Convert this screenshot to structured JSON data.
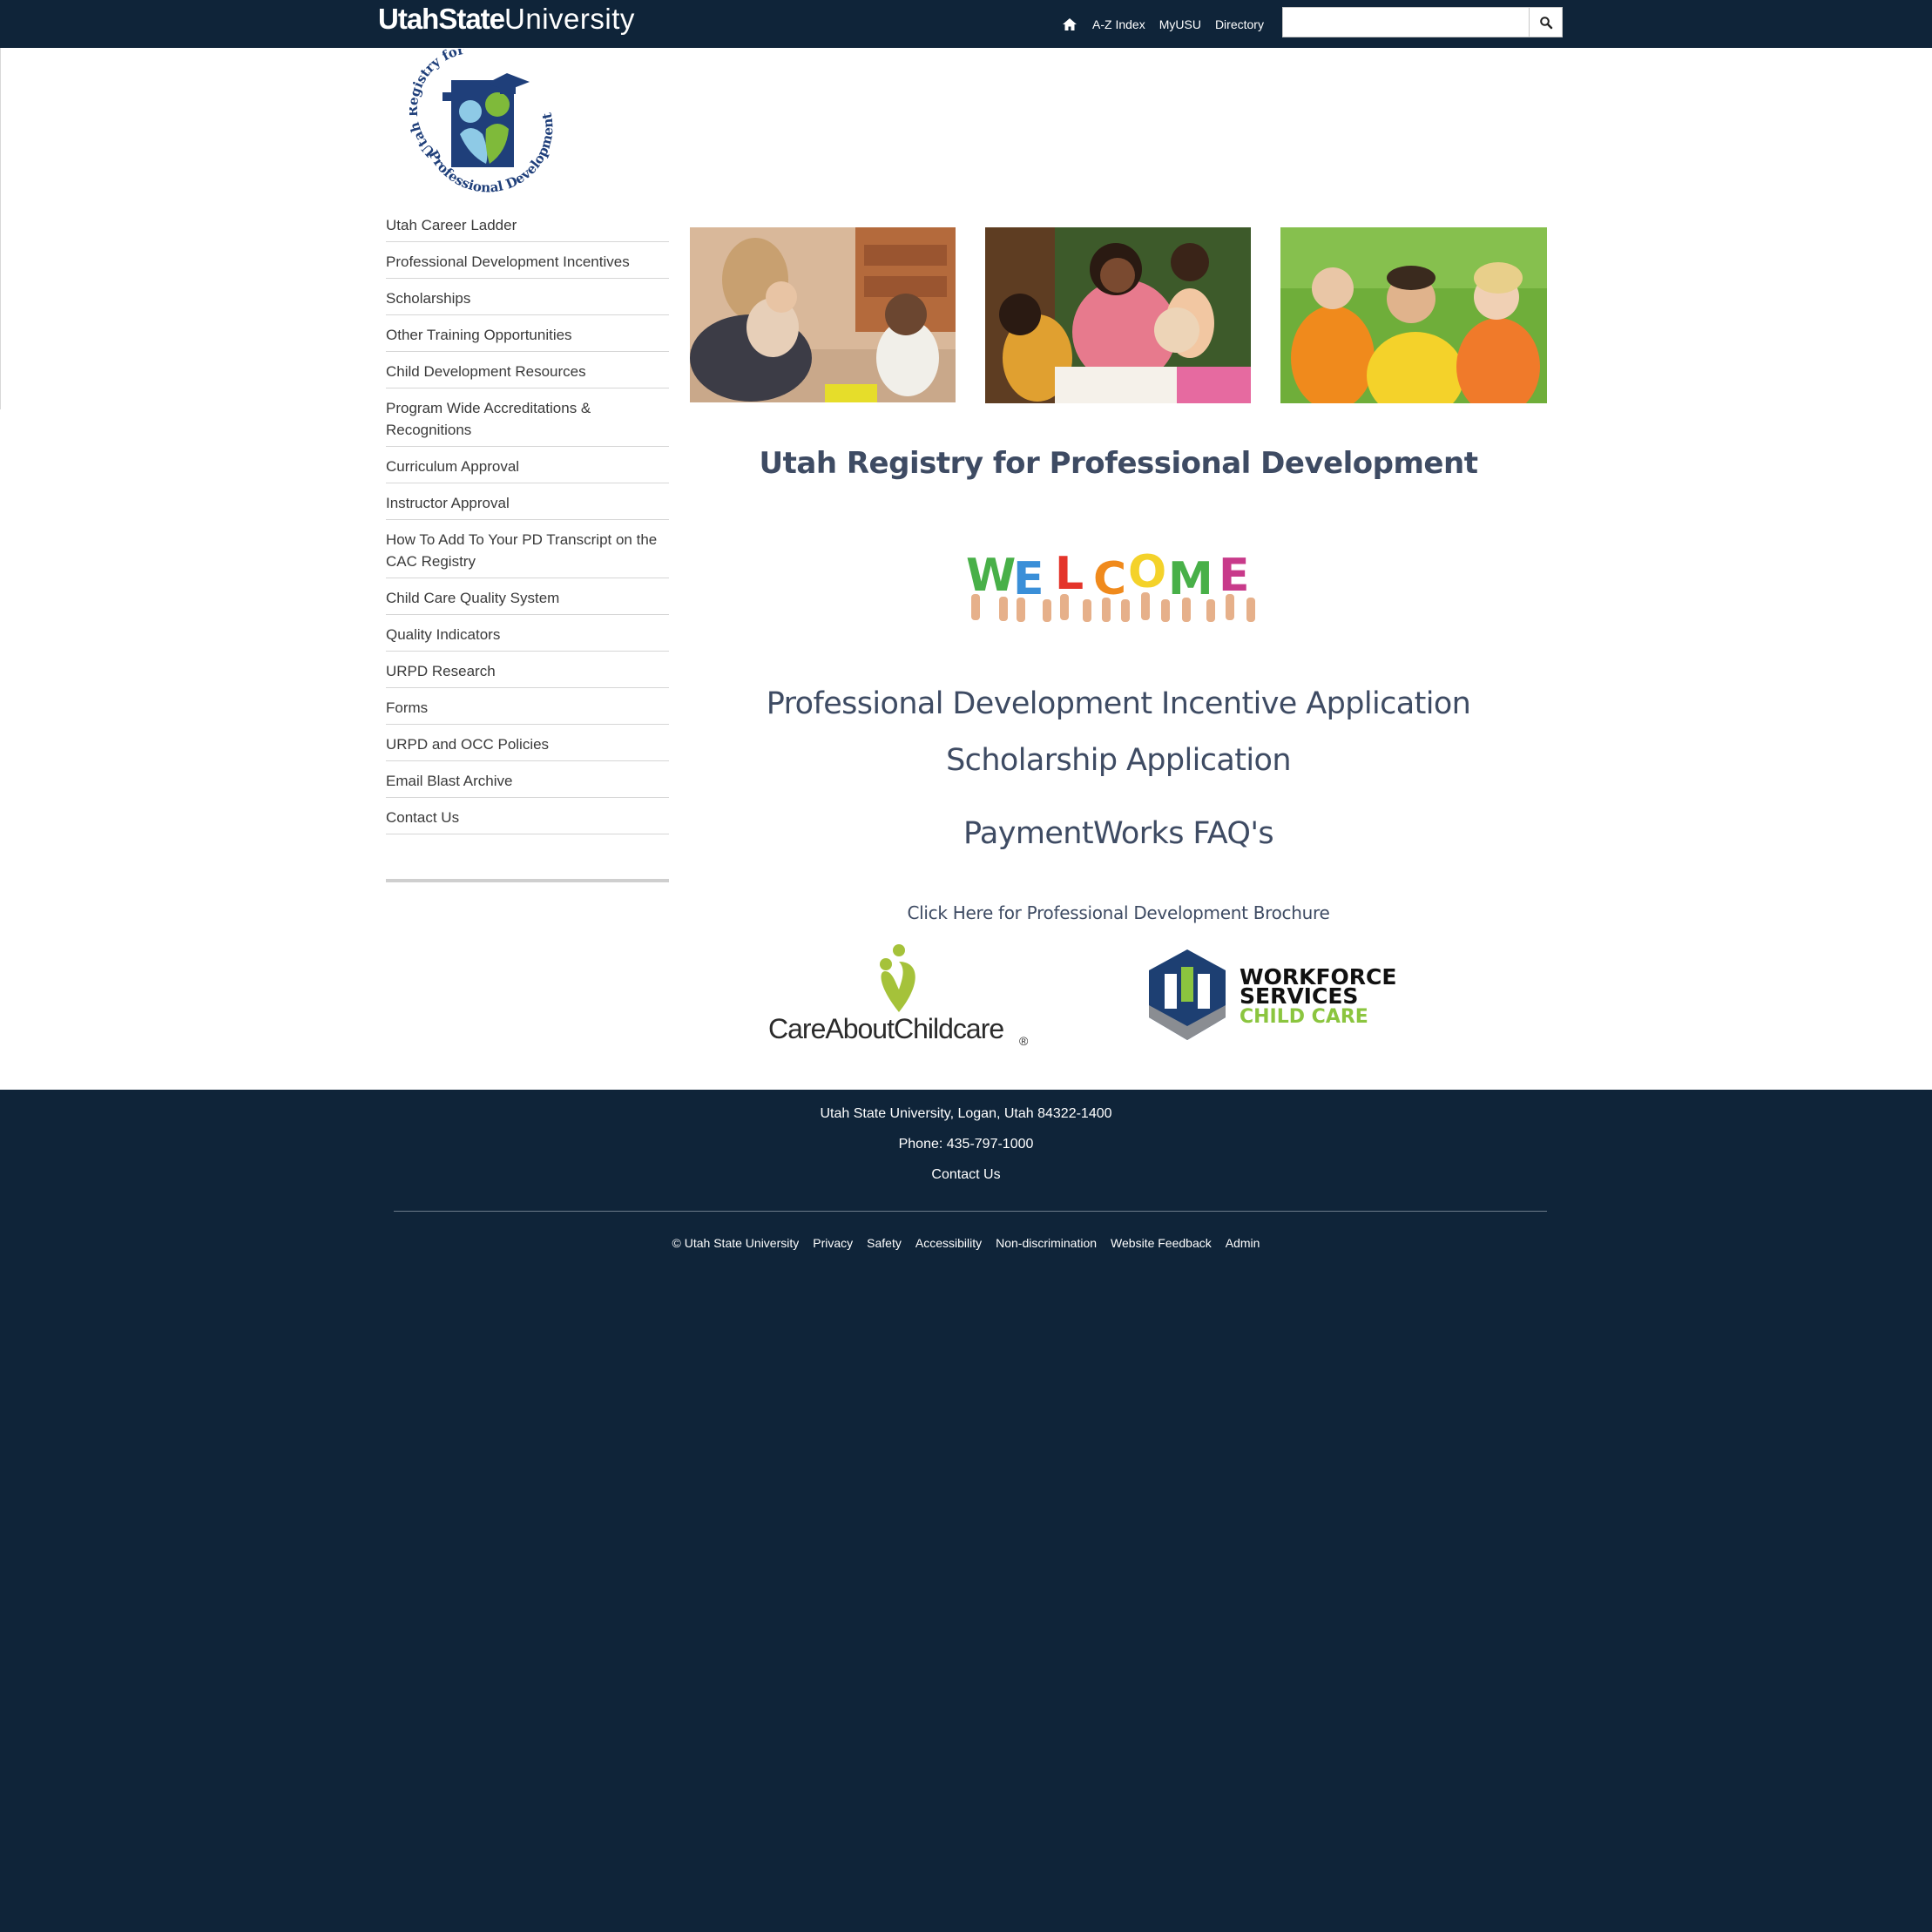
{
  "header": {
    "brand_bold": "UtahState",
    "brand_regular": "University",
    "nav": [
      "A-Z Index",
      "MyUSU",
      "Directory"
    ],
    "search": {
      "placeholder": "",
      "value": ""
    },
    "icons": {
      "home": "home-icon",
      "search": "search-icon"
    }
  },
  "logo": {
    "text_top": "Utah Registry for",
    "text_bottom": "Professional Development"
  },
  "sidebar": {
    "items": [
      "Utah Career Ladder",
      "Professional Development Incentives",
      "Scholarships",
      "Other Training Opportunities",
      "Child Development Resources",
      "Program Wide Accreditations & Recognitions",
      "Curriculum Approval",
      "Instructor Approval",
      "How To Add To Your PD Transcript on the CAC Registry",
      "Child Care Quality System",
      "Quality Indicators",
      "URPD Research",
      "Forms",
      "URPD and OCC Policies",
      "Email Blast Archive",
      "Contact Us"
    ]
  },
  "main": {
    "title": "Utah Registry for Professional Development",
    "welcome_letters": [
      "W",
      "E",
      "L",
      "C",
      "O",
      "M",
      "E"
    ],
    "links": {
      "pdi": "Professional Development Incentive Application",
      "scholarship": "Scholarship Application",
      "paymentworks": "PaymentWorks FAQ's",
      "brochure": "Click Here for Professional Development Brochure"
    },
    "partners": {
      "cac": "CareAboutChildcare",
      "cac_mark": "®",
      "wfs_line1": "WORKFORCE",
      "wfs_line2": "SERVICES",
      "wfs_line3": "CHILD CARE"
    }
  },
  "footer": {
    "address": "Utah State University, Logan, Utah 84322-1400",
    "phone": "Phone: 435-797-1000",
    "contact": "Contact Us",
    "links": [
      "© Utah State University",
      "Privacy",
      "Safety",
      "Accessibility",
      "Non-discrimination",
      "Website Feedback",
      "Admin"
    ]
  },
  "colors": {
    "navy": "#0f2439",
    "heading": "#3e4b63",
    "logo_blue": "#1f3f7a",
    "logo_light_blue": "#8ecae6",
    "logo_green": "#7fba3a",
    "cac_green": "#a5c23a",
    "wfs_blue": "#1d3f72",
    "wfs_green": "#8bc53f"
  }
}
